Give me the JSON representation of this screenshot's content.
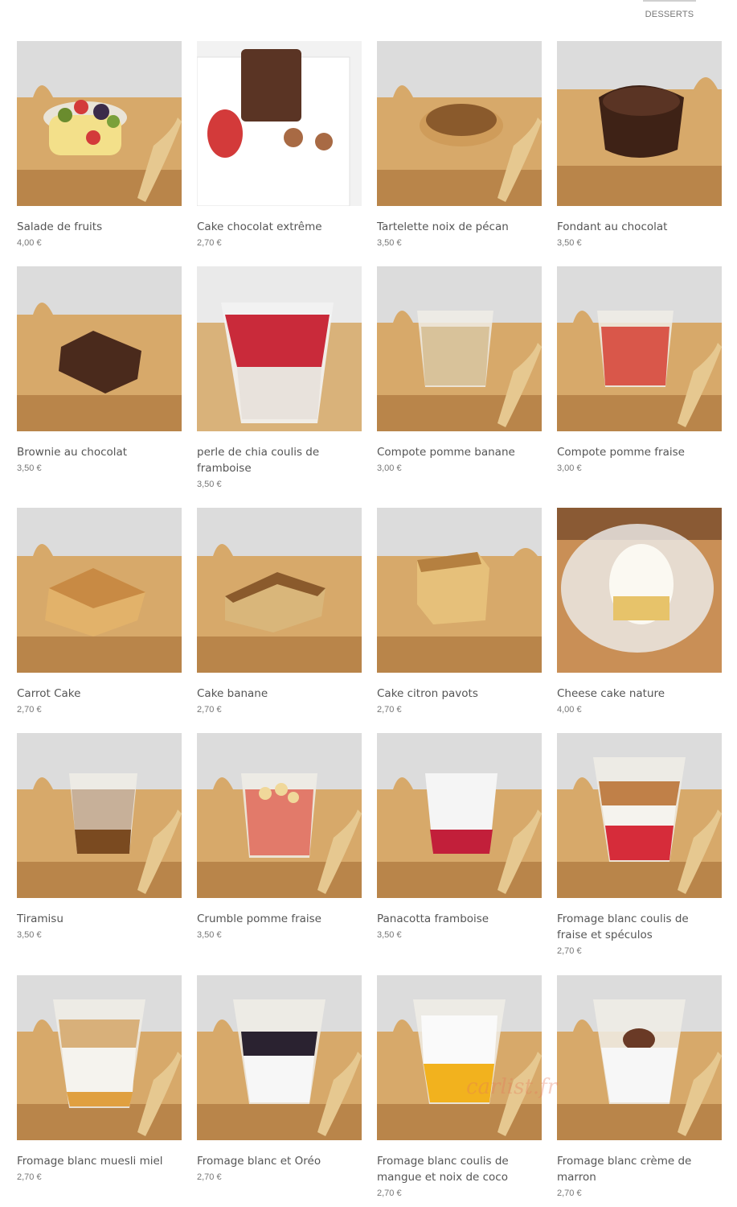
{
  "nav": {
    "active_tab": "DESSERTS"
  },
  "products": [
    {
      "name": "Salade de fruits",
      "price": "4,00 €",
      "icon": "fruit-salad-cup"
    },
    {
      "name": "Cake chocolat extrême",
      "price": "2,70 €",
      "icon": "chocolate-cake-slice"
    },
    {
      "name": "Tartelette noix de pécan",
      "price": "3,50 €",
      "icon": "pecan-tart"
    },
    {
      "name": "Fondant au chocolat",
      "price": "3,50 €",
      "icon": "chocolate-fondant"
    },
    {
      "name": "Brownie au chocolat",
      "price": "3,50 €",
      "icon": "brownie"
    },
    {
      "name": "perle de chia coulis de framboise",
      "price": "3,50 €",
      "icon": "chia-raspberry-cup"
    },
    {
      "name": "Compote pomme banane",
      "price": "3,00 €",
      "icon": "apple-banana-compote"
    },
    {
      "name": "Compote pomme fraise",
      "price": "3,00 €",
      "icon": "apple-strawberry-compote"
    },
    {
      "name": "Carrot Cake",
      "price": "2,70 €",
      "icon": "carrot-cake-slice"
    },
    {
      "name": "Cake banane",
      "price": "2,70 €",
      "icon": "banana-cake-slice"
    },
    {
      "name": "Cake citron pavots",
      "price": "2,70 €",
      "icon": "lemon-poppy-cake"
    },
    {
      "name": "Cheese cake nature",
      "price": "4,00 €",
      "icon": "cheesecake"
    },
    {
      "name": "Tiramisu",
      "price": "3,50 €",
      "icon": "tiramisu-cup"
    },
    {
      "name": "Crumble pomme fraise",
      "price": "3,50 €",
      "icon": "crumble-cup"
    },
    {
      "name": "Panacotta framboise",
      "price": "3,50 €",
      "icon": "panacotta-cup"
    },
    {
      "name": "Fromage blanc coulis de fraise et spéculos",
      "price": "2,70 €",
      "icon": "fromage-blanc-strawberry-cup"
    },
    {
      "name": "Fromage blanc muesli miel",
      "price": "2,70 €",
      "icon": "fromage-blanc-muesli-cup"
    },
    {
      "name": "Fromage blanc et Oréo",
      "price": "2,70 €",
      "icon": "fromage-blanc-oreo-cup"
    },
    {
      "name": "Fromage blanc coulis de mangue et noix de coco",
      "price": "2,70 €",
      "icon": "fromage-blanc-mango-cup"
    },
    {
      "name": "Fromage blanc crème de marron",
      "price": "2,70 €",
      "icon": "fromage-blanc-chestnut-cup"
    }
  ],
  "watermark": "carlist.fr",
  "colors": {
    "wall": "#d9d9d9",
    "board": "#d7a96a",
    "board_dark": "#b9854a",
    "plate": "#f6f6f6",
    "chocolate": "#4a2a1c",
    "strawberry": "#d33a3a",
    "cream": "#f4f1ea",
    "cake": "#d9a760"
  }
}
